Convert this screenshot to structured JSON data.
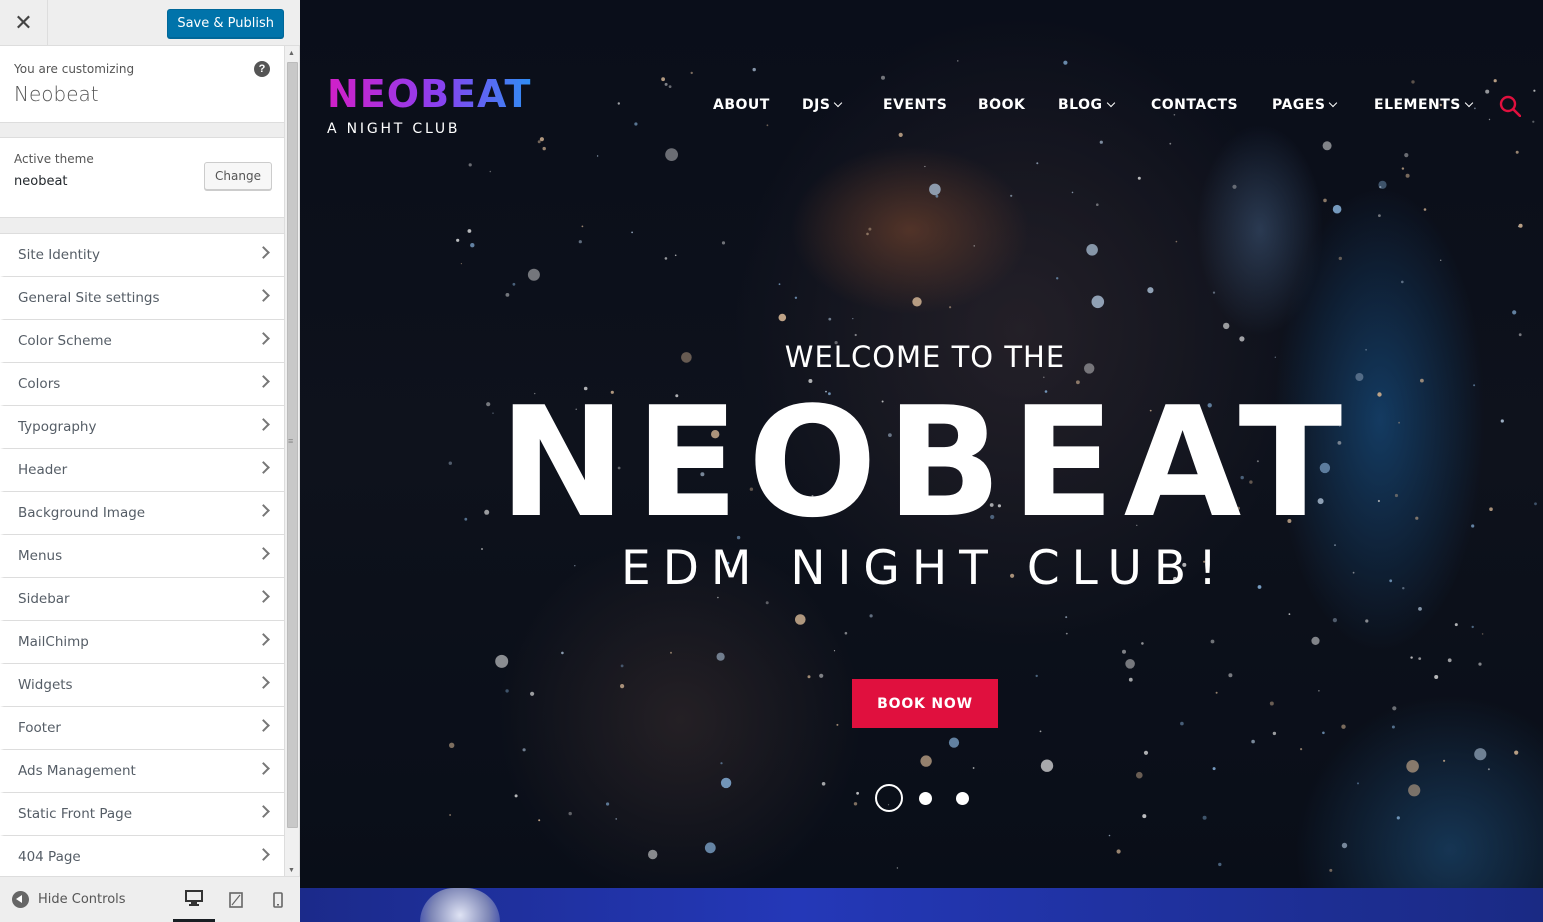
{
  "customizer": {
    "save_label": "Save & Publish",
    "customizing_label": "You are customizing",
    "site_name": "Neobeat",
    "active_theme_label": "Active theme",
    "active_theme_name": "neobeat",
    "change_label": "Change",
    "sections": [
      {
        "label": "Site Identity"
      },
      {
        "label": "General Site settings"
      },
      {
        "label": "Color Scheme"
      },
      {
        "label": "Colors"
      },
      {
        "label": "Typography"
      },
      {
        "label": "Header"
      },
      {
        "label": "Background Image"
      },
      {
        "label": "Menus"
      },
      {
        "label": "Sidebar"
      },
      {
        "label": "MailChimp"
      },
      {
        "label": "Widgets"
      },
      {
        "label": "Footer"
      },
      {
        "label": "Ads Management"
      },
      {
        "label": "Static Front Page"
      },
      {
        "label": "404 Page"
      }
    ],
    "hide_controls_label": "Hide Controls",
    "device_icons": [
      "desktop-icon",
      "tablet-icon",
      "mobile-icon"
    ],
    "active_device": "desktop"
  },
  "site": {
    "logo_title": "NEOBEAT",
    "logo_subtitle": "A NIGHT CLUB",
    "nav": [
      {
        "label": "ABOUT",
        "dropdown": false
      },
      {
        "label": "DJS",
        "dropdown": true
      },
      {
        "label": "EVENTS",
        "dropdown": false
      },
      {
        "label": "BOOK",
        "dropdown": false
      },
      {
        "label": "BLOG",
        "dropdown": true
      },
      {
        "label": "CONTACTS",
        "dropdown": false
      },
      {
        "label": "PAGES",
        "dropdown": true
      },
      {
        "label": "ELEMENTS",
        "dropdown": true
      }
    ],
    "hero": {
      "welcome": "WELCOME TO THE",
      "title": "NEOBEAT",
      "subtitle": "EDM NIGHT CLUB!",
      "button": "BOOK NOW",
      "slides": 3,
      "active_slide": 1
    }
  },
  "colors": {
    "wp_blue": "#0073aa",
    "accent_red": "#e0103e",
    "logo_gradient_start": "#d21fc7",
    "logo_gradient_end": "#2f8ef4",
    "search_icon": "#e0103e"
  }
}
